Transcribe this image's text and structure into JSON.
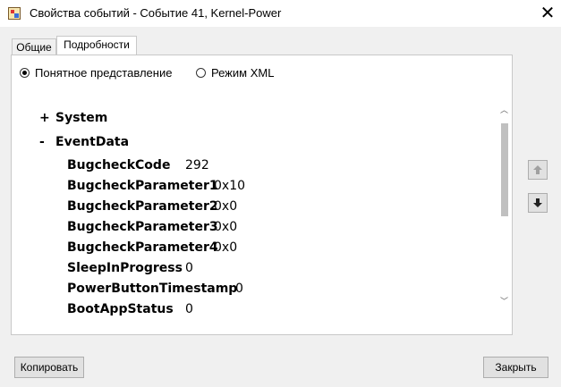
{
  "window": {
    "title": "Свойства событий - Событие 41, Kernel-Power"
  },
  "tabs": [
    {
      "label": "Общие"
    },
    {
      "label": "Подробности"
    }
  ],
  "view_mode": {
    "options": [
      {
        "label": "Понятное представление",
        "checked": true
      },
      {
        "label": "Режим XML",
        "checked": false
      }
    ]
  },
  "tree": {
    "system": {
      "toggle": "+",
      "label": "System"
    },
    "eventdata": {
      "toggle": "-",
      "label": "EventData"
    },
    "fields": [
      {
        "name": "BugcheckCode",
        "value": "292"
      },
      {
        "name": "BugcheckParameter1",
        "value": "0x10"
      },
      {
        "name": "BugcheckParameter2",
        "value": "0x0"
      },
      {
        "name": "BugcheckParameter3",
        "value": "0x0"
      },
      {
        "name": "BugcheckParameter4",
        "value": "0x0"
      },
      {
        "name": "SleepInProgress",
        "value": "0"
      },
      {
        "name": "PowerButtonTimestamp",
        "value": "0"
      },
      {
        "name": "BootAppStatus",
        "value": "0"
      }
    ]
  },
  "buttons": {
    "copy": "Копировать",
    "close": "Закрыть"
  },
  "icons": {
    "up": "arrow-up-icon",
    "down": "arrow-down-icon"
  },
  "colors": {
    "accent_disabled": "#a0a0a0",
    "button_bg": "#e1e1e1"
  }
}
